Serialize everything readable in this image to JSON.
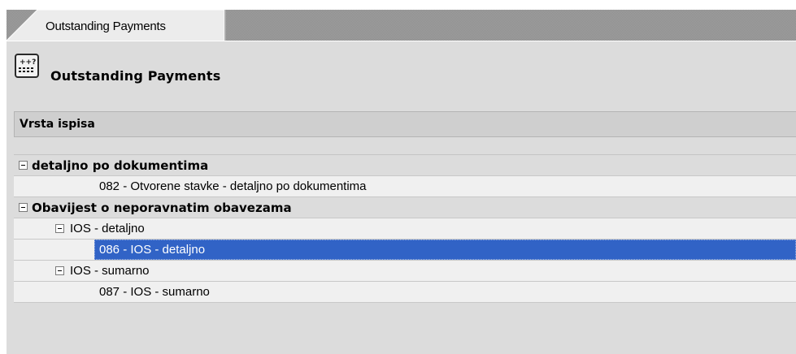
{
  "tab": {
    "label": "Outstanding Payments"
  },
  "title": {
    "text": "Outstanding Payments",
    "icon": "calculator-icon"
  },
  "section": {
    "label": "Vrsta ispisa"
  },
  "tree": {
    "rows": [
      {
        "level": 0,
        "kind": "group",
        "label": "detaljno po dokumentima",
        "expanded": true
      },
      {
        "level": 2,
        "kind": "leaf",
        "label": "082 - Otvorene stavke - detaljno po dokumentima"
      },
      {
        "level": 0,
        "kind": "group",
        "label": "Obavijest o neporavnatim obavezama",
        "expanded": true
      },
      {
        "level": 1,
        "kind": "sub",
        "label": "IOS - detaljno",
        "expanded": true
      },
      {
        "level": 2,
        "kind": "leaf",
        "label": "086 - IOS - detaljno",
        "selected": true
      },
      {
        "level": 1,
        "kind": "sub",
        "label": "IOS - sumarno",
        "expanded": true
      },
      {
        "level": 2,
        "kind": "leaf",
        "label": "087 - IOS - sumarno"
      }
    ]
  },
  "colors": {
    "selection": "#3163c6",
    "panel": "#dcdcdc",
    "tab_band": "#8f8f8f"
  }
}
